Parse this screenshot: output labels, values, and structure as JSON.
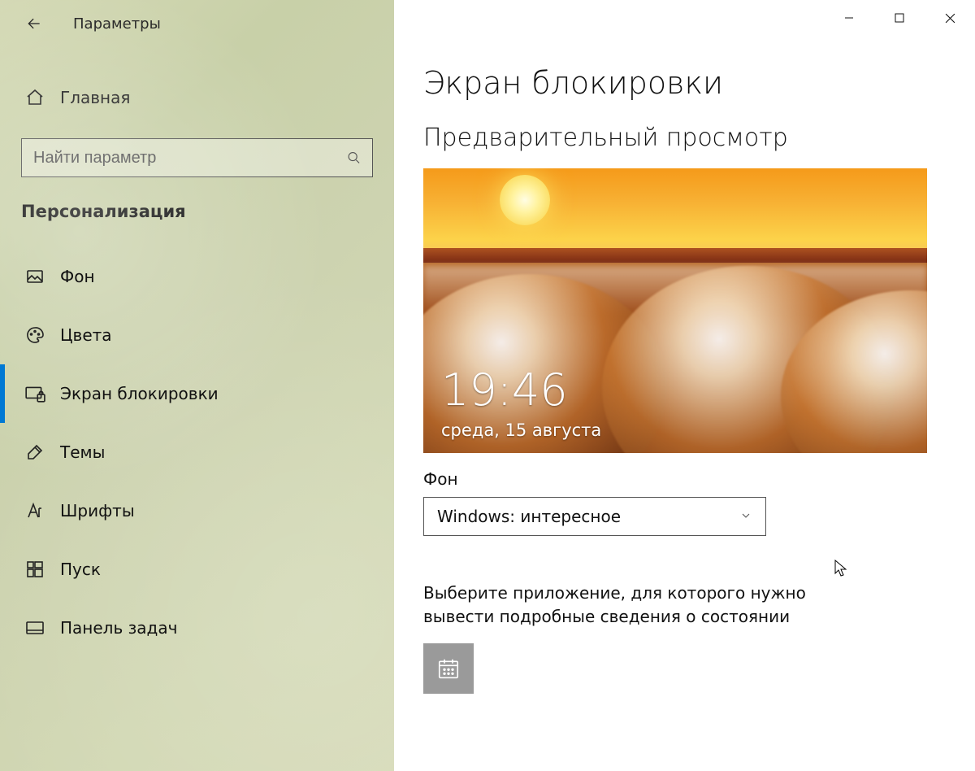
{
  "app_title": "Параметры",
  "window_controls": {
    "minimize": "−",
    "maximize": "☐",
    "close": "✕"
  },
  "sidebar": {
    "home_label": "Главная",
    "search_placeholder": "Найти параметр",
    "category": "Персонализация",
    "items": [
      {
        "label": "Фон",
        "icon": "picture-icon"
      },
      {
        "label": "Цвета",
        "icon": "palette-icon"
      },
      {
        "label": "Экран блокировки",
        "icon": "lockscreen-icon",
        "selected": true
      },
      {
        "label": "Темы",
        "icon": "theme-icon"
      },
      {
        "label": "Шрифты",
        "icon": "font-icon"
      },
      {
        "label": "Пуск",
        "icon": "start-icon"
      },
      {
        "label": "Панель задач",
        "icon": "taskbar-icon"
      }
    ]
  },
  "main": {
    "page_title": "Экран блокировки",
    "preview_section": "Предварительный просмотр",
    "preview": {
      "time": "19:46",
      "date": "среда, 15 августа"
    },
    "background_label": "Фон",
    "background_dropdown": "Windows: интересное",
    "detailed_status_text": "Выберите приложение, для которого нужно вывести подробные сведения о состоянии",
    "detailed_status_app_icon": "calendar-icon"
  }
}
